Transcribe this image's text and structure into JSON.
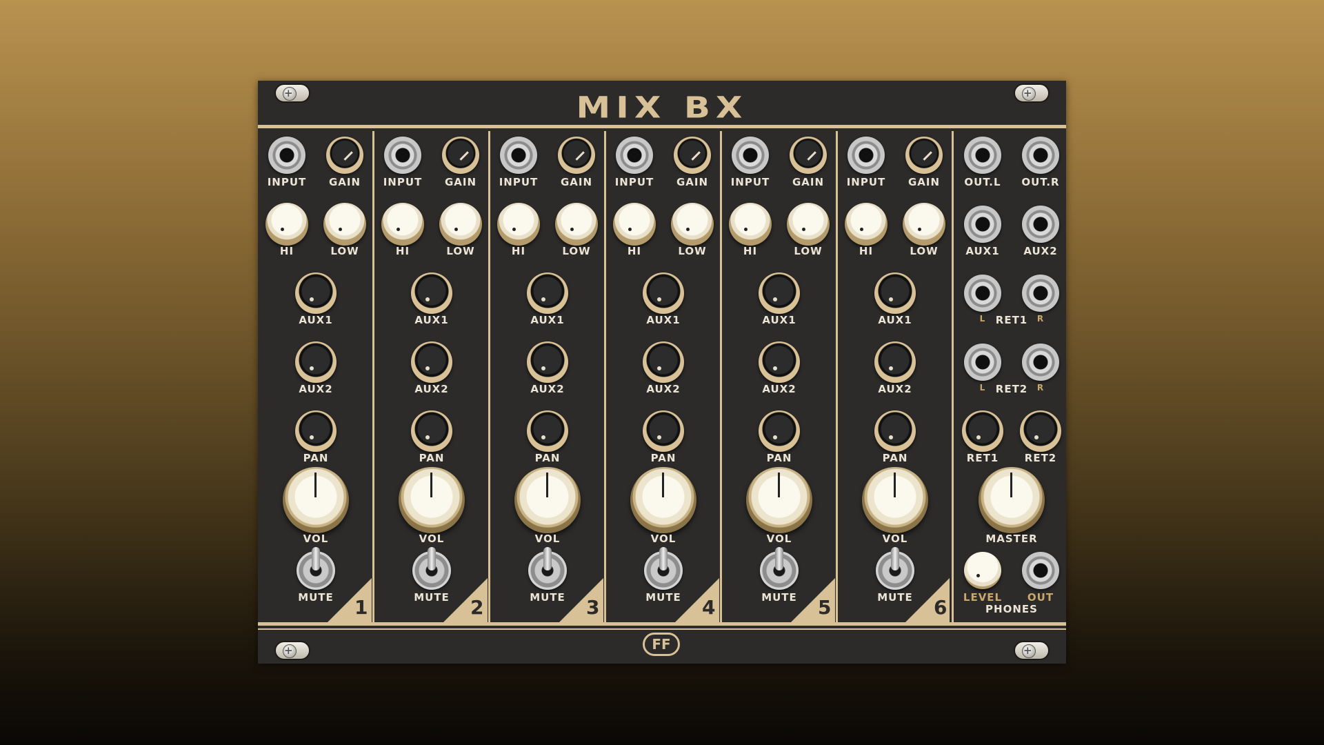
{
  "title": "MIX BX",
  "logo_text": "FF",
  "channel_labels": {
    "input": "INPUT",
    "gain": "GAIN",
    "hi": "HI",
    "low": "LOW",
    "aux1": "AUX1",
    "aux2": "AUX2",
    "pan": "PAN",
    "vol": "VOL",
    "mute": "MUTE"
  },
  "channels": [
    "1",
    "2",
    "3",
    "4",
    "5",
    "6"
  ],
  "master": {
    "out_l": "OUT.L",
    "out_r": "OUT.R",
    "aux1": "AUX1",
    "aux2": "AUX2",
    "ret1": "RET1",
    "ret2": "RET2",
    "l": "L",
    "r": "R",
    "ret1_knob": "RET1",
    "ret2_knob": "RET2",
    "master": "MASTER",
    "level": "LEVEL",
    "out": "OUT",
    "phones": "PHONES"
  },
  "colors": {
    "panel": "#2c2b2a",
    "accent": "#d8c196",
    "label": "#ece5d6"
  }
}
